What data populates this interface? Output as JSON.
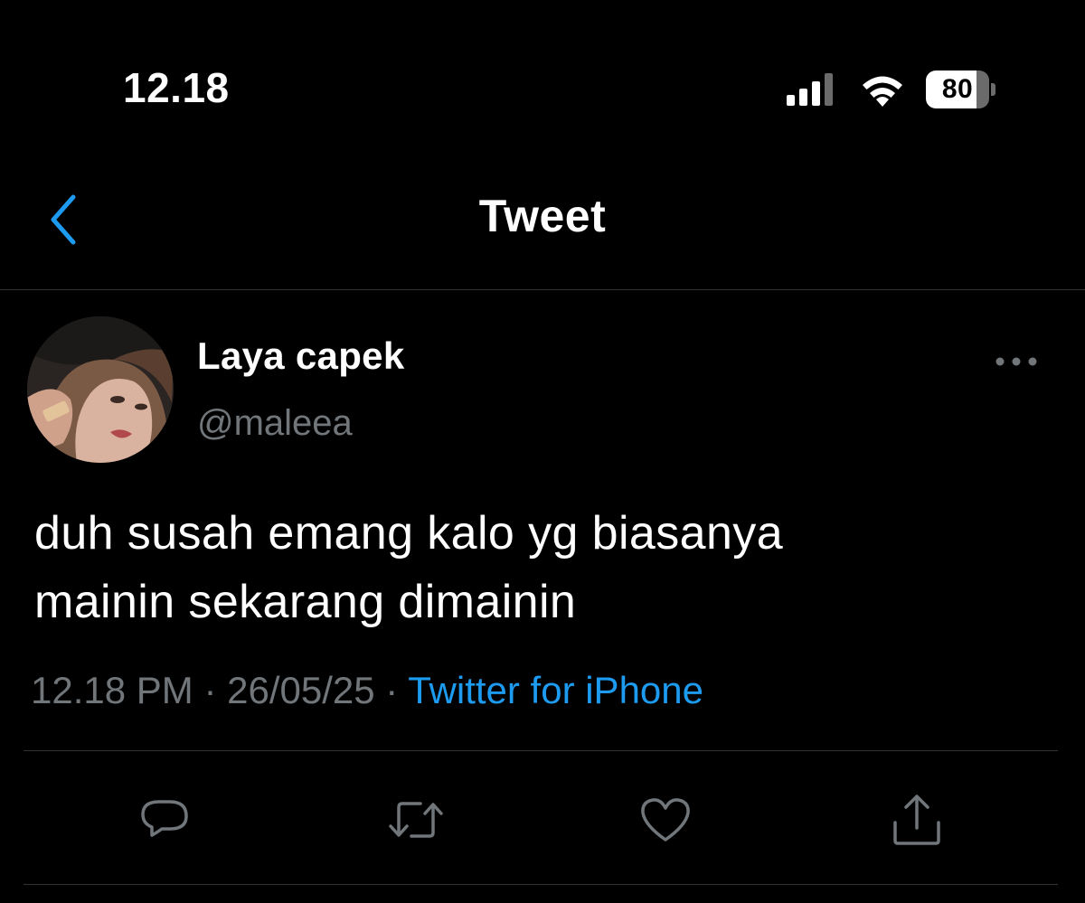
{
  "status_bar": {
    "time": "12.18",
    "battery_level": "80",
    "icons": [
      "signal-icon",
      "wifi-icon",
      "battery-icon"
    ]
  },
  "nav": {
    "title": "Tweet",
    "back_icon": "chevron-left-icon"
  },
  "tweet": {
    "author": {
      "display_name": "Laya capek",
      "handle": "@maleea",
      "avatar": "avatar"
    },
    "more_icon": "more-horizontal-icon",
    "text_lines": [
      "duh susah emang kalo yg biasanya",
      "mainin sekarang dimainin"
    ],
    "time": "12.18 PM",
    "separator": " · ",
    "date": "26/05/25",
    "source": "Twitter for iPhone"
  },
  "actions": [
    {
      "icon": "reply-icon"
    },
    {
      "icon": "retweet-icon"
    },
    {
      "icon": "like-icon"
    },
    {
      "icon": "share-icon"
    }
  ],
  "colors": {
    "background": "#000000",
    "text": "#ffffff",
    "secondary_text": "#71767b",
    "accent": "#1d9bf0",
    "divider": "#2f3336"
  }
}
